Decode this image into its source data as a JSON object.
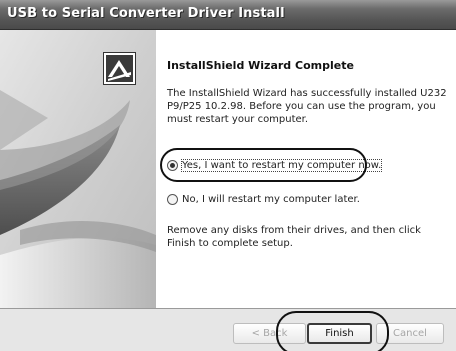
{
  "window": {
    "title": "USB to Serial Converter Driver Install"
  },
  "main": {
    "logo_icon": "installshield-logo-icon",
    "heading": "InstallShield Wizard Complete",
    "description": "The InstallShield Wizard has successfully installed U232 P9/P25 10.2.98.  Before you can use the program, you must restart your computer.",
    "options": [
      {
        "label": "Yes, I want to restart my computer now.",
        "selected": true
      },
      {
        "label": "No, I will restart my computer later.",
        "selected": false
      }
    ],
    "remove_text": "Remove any disks from their drives, and then click Finish to complete setup."
  },
  "buttons": {
    "back": "< Back",
    "finish": "Finish",
    "cancel": "Cancel"
  }
}
